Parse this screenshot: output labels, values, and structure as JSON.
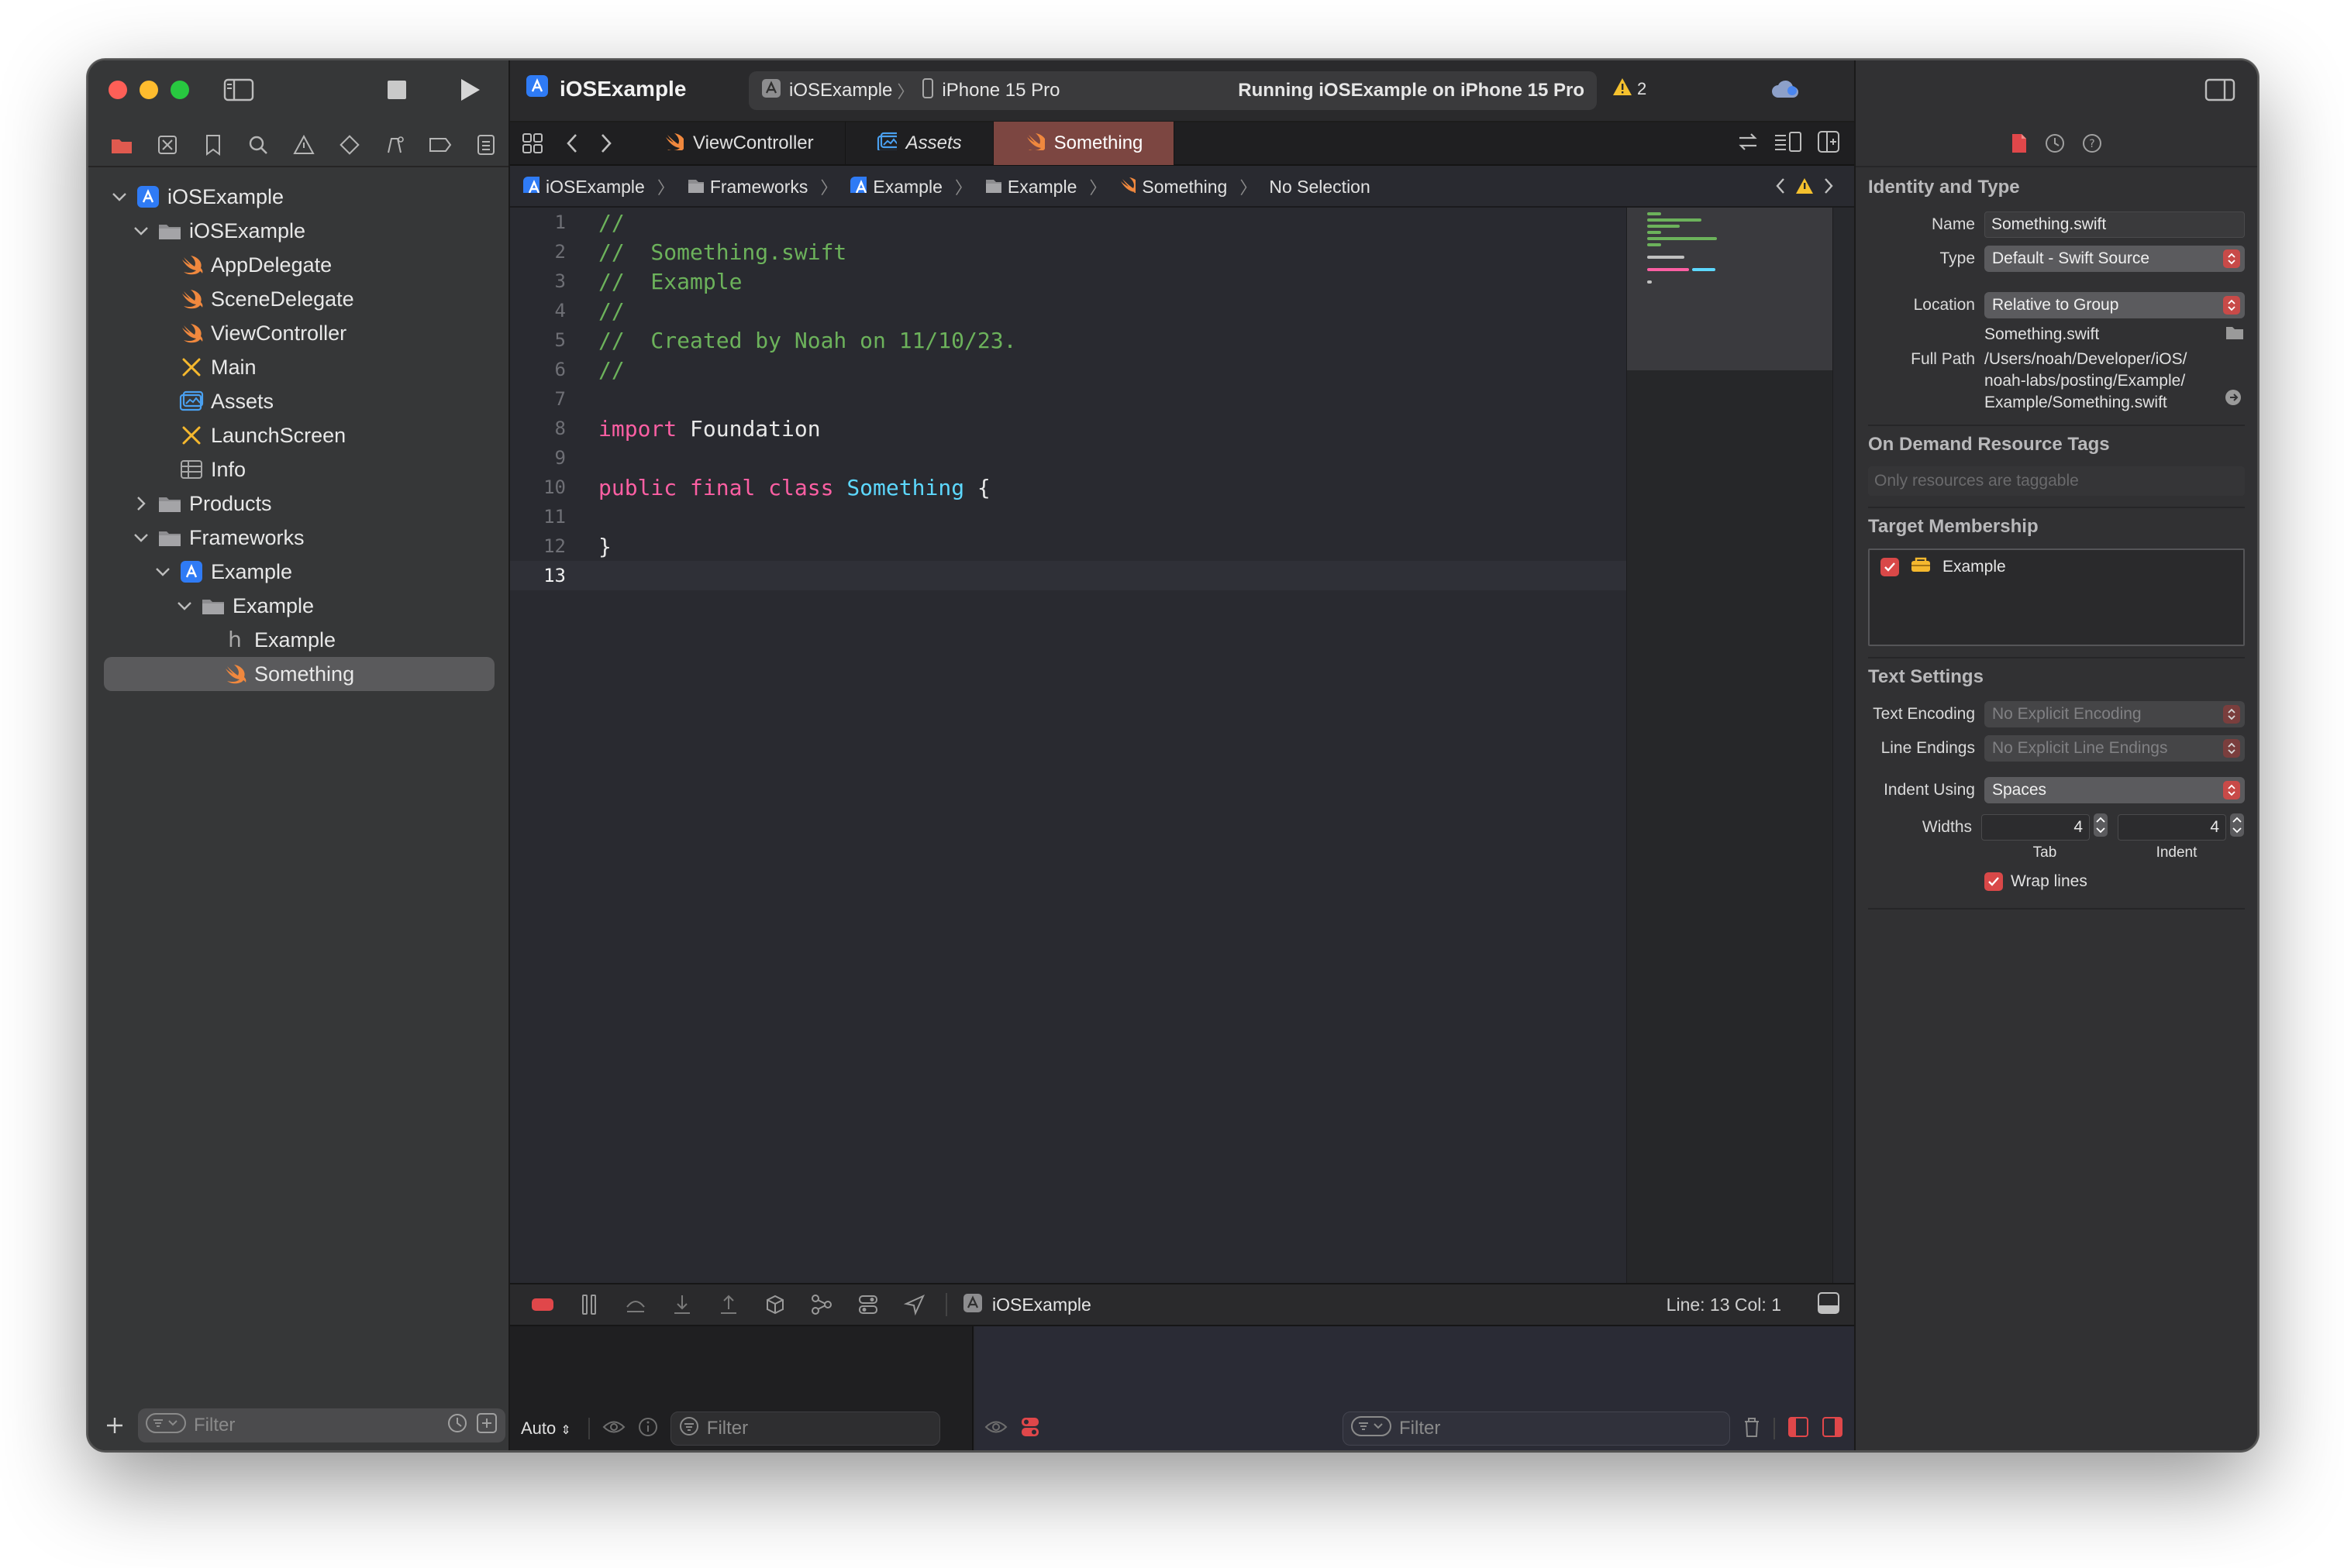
{
  "navigator": {
    "tree": [
      {
        "label": "iOSExample",
        "icon": "app-project-icon",
        "chevron": "down",
        "level": 0
      },
      {
        "label": "iOSExample",
        "icon": "folder-icon",
        "chevron": "down",
        "level": 1
      },
      {
        "label": "AppDelegate",
        "icon": "swift-file-icon",
        "chevron": "",
        "level": 2
      },
      {
        "label": "SceneDelegate",
        "icon": "swift-file-icon",
        "chevron": "",
        "level": 2
      },
      {
        "label": "ViewController",
        "icon": "swift-file-icon",
        "chevron": "",
        "level": 2
      },
      {
        "label": "Main",
        "icon": "storyboard-icon",
        "chevron": "",
        "level": 2
      },
      {
        "label": "Assets",
        "icon": "assets-icon",
        "chevron": "",
        "level": 2
      },
      {
        "label": "LaunchScreen",
        "icon": "storyboard-icon",
        "chevron": "",
        "level": 2
      },
      {
        "label": "Info",
        "icon": "plist-icon",
        "chevron": "",
        "level": 2
      },
      {
        "label": "Products",
        "icon": "folder-icon",
        "chevron": "right",
        "level": 1
      },
      {
        "label": "Frameworks",
        "icon": "folder-icon",
        "chevron": "down",
        "level": 1
      },
      {
        "label": "Example",
        "icon": "framework-icon",
        "chevron": "down",
        "level": 2
      },
      {
        "label": "Example",
        "icon": "folder-icon",
        "chevron": "down",
        "level": 3
      },
      {
        "label": "Example",
        "icon": "header-file-icon",
        "chevron": "",
        "level": 4
      },
      {
        "label": "Something",
        "icon": "swift-file-icon",
        "chevron": "",
        "level": 4,
        "selected": true
      }
    ],
    "filter_placeholder": "Filter"
  },
  "toolbar": {
    "project_title": "iOSExample",
    "scheme": "iOSExample",
    "destination": "iPhone 15 Pro",
    "status": "Running iOSExample on iPhone 15 Pro",
    "warning_count": "2"
  },
  "tabs": [
    {
      "label": "ViewController",
      "icon": "swift-file-icon",
      "italic": false,
      "active": false
    },
    {
      "label": "Assets",
      "icon": "assets-icon",
      "italic": true,
      "active": false
    },
    {
      "label": "Something",
      "icon": "swift-file-icon",
      "italic": false,
      "active": true
    }
  ],
  "jumpbar": {
    "items": [
      "iOSExample",
      "Frameworks",
      "Example",
      "Example",
      "Something",
      "No Selection"
    ]
  },
  "editor": {
    "current_line": 13,
    "lines": [
      [
        {
          "t": "//",
          "c": "c-comment"
        }
      ],
      [
        {
          "t": "//  Something.swift",
          "c": "c-comment"
        }
      ],
      [
        {
          "t": "//  Example",
          "c": "c-comment"
        }
      ],
      [
        {
          "t": "//",
          "c": "c-comment"
        }
      ],
      [
        {
          "t": "//  Created by Noah on 11/10/23.",
          "c": "c-comment"
        }
      ],
      [
        {
          "t": "//",
          "c": "c-comment"
        }
      ],
      [],
      [
        {
          "t": "import",
          "c": "c-kw"
        },
        {
          "t": " Foundation",
          "c": "c-plain"
        }
      ],
      [],
      [
        {
          "t": "public",
          "c": "c-kw"
        },
        {
          "t": " ",
          "c": "c-plain"
        },
        {
          "t": "final",
          "c": "c-kw"
        },
        {
          "t": " ",
          "c": "c-plain"
        },
        {
          "t": "class",
          "c": "c-kw"
        },
        {
          "t": " ",
          "c": "c-plain"
        },
        {
          "t": "Something",
          "c": "c-type"
        },
        {
          "t": " {",
          "c": "c-plain"
        }
      ],
      [],
      [
        {
          "t": "}",
          "c": "c-plain"
        }
      ],
      []
    ]
  },
  "debugbar": {
    "process": "iOSExample",
    "position": "Line: 13  Col: 1"
  },
  "console": {
    "mode": "Auto",
    "filter_placeholder_left": "Filter",
    "filter_placeholder_right": "Filter"
  },
  "inspector": {
    "identity": {
      "title": "Identity and Type",
      "name_label": "Name",
      "name_value": "Something.swift",
      "type_label": "Type",
      "type_value": "Default - Swift Source",
      "location_label": "Location",
      "location_value": "Relative to Group",
      "location_file": "Something.swift",
      "fullpath_label": "Full Path",
      "fullpath_line1": "/Users/noah/Developer/iOS/",
      "fullpath_line2": "noah-labs/posting/Example/",
      "fullpath_line3": "Example/Something.swift"
    },
    "ondemand": {
      "title": "On Demand Resource Tags",
      "placeholder": "Only resources are taggable"
    },
    "membership": {
      "title": "Target Membership",
      "target": "Example"
    },
    "text_settings": {
      "title": "Text Settings",
      "encoding_label": "Text Encoding",
      "encoding_value": "No Explicit Encoding",
      "endings_label": "Line Endings",
      "endings_value": "No Explicit Line Endings",
      "indent_label": "Indent Using",
      "indent_value": "Spaces",
      "widths_label": "Widths",
      "tab_value": "4",
      "indent_value_num": "4",
      "tab_caption": "Tab",
      "indent_caption": "Indent",
      "wrap_label": "Wrap lines"
    }
  },
  "colors": {
    "accent_red": "#d94848",
    "swift_orange": "#f0883e",
    "project_blue": "#2f7bf5"
  }
}
